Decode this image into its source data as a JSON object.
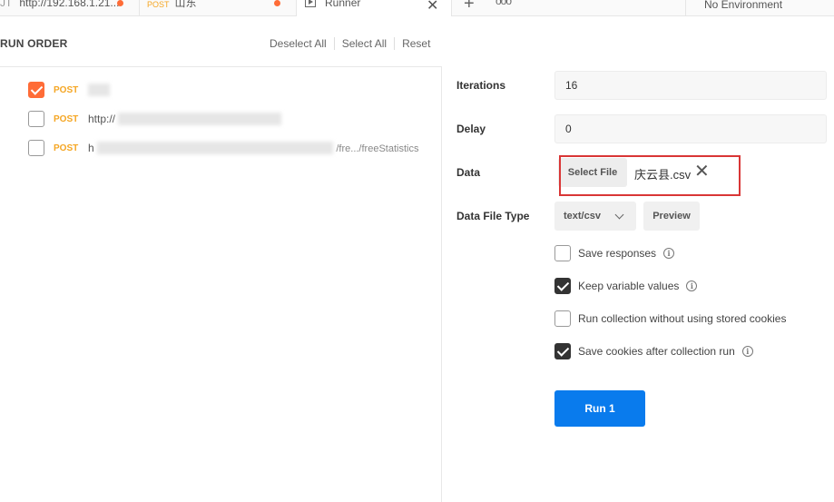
{
  "tabs": [
    {
      "method": "",
      "title": "http://192.168.1.21...",
      "unsaved": true
    },
    {
      "method": "POST",
      "title": "山东",
      "unsaved": true
    },
    {
      "title": "Runner",
      "close_icon": "close-icon"
    }
  ],
  "tabbar": {
    "new_tab_icon": "plus-icon",
    "more_icon": "ellipsis-icon"
  },
  "environment": {
    "selected": "No Environment"
  },
  "run_order": {
    "title": "RUN ORDER",
    "actions": [
      "Deselect All",
      "Select All",
      "Reset"
    ],
    "requests": [
      {
        "method": "POST",
        "url": "",
        "checked": true
      },
      {
        "method": "POST",
        "url": "http://",
        "checked": false
      },
      {
        "method": "POST",
        "url": "h",
        "url_tail": "/fre.../freeStatistics",
        "checked": false
      }
    ]
  },
  "config": {
    "iterations": {
      "label": "Iterations",
      "value": "16"
    },
    "delay": {
      "label": "Delay",
      "value": "0"
    },
    "data": {
      "label": "Data",
      "select_button": "Select File",
      "file_name": "庆云县.csv",
      "remove_icon": "close-icon"
    },
    "data_file_type": {
      "label": "Data File Type",
      "selected": "text/csv",
      "preview_button": "Preview"
    },
    "options": [
      {
        "label": "Save responses",
        "checked": false
      },
      {
        "label": "Keep variable values",
        "checked": true
      },
      {
        "label": "Run collection without using stored cookies",
        "checked": false
      },
      {
        "label": "Save cookies after collection run",
        "checked": true
      }
    ],
    "run_button": "Run 1"
  },
  "colors": {
    "accent": "#ff6c37",
    "run_button": "#097bed",
    "method_post": "#f5a623",
    "highlight_box": "#d93636"
  }
}
